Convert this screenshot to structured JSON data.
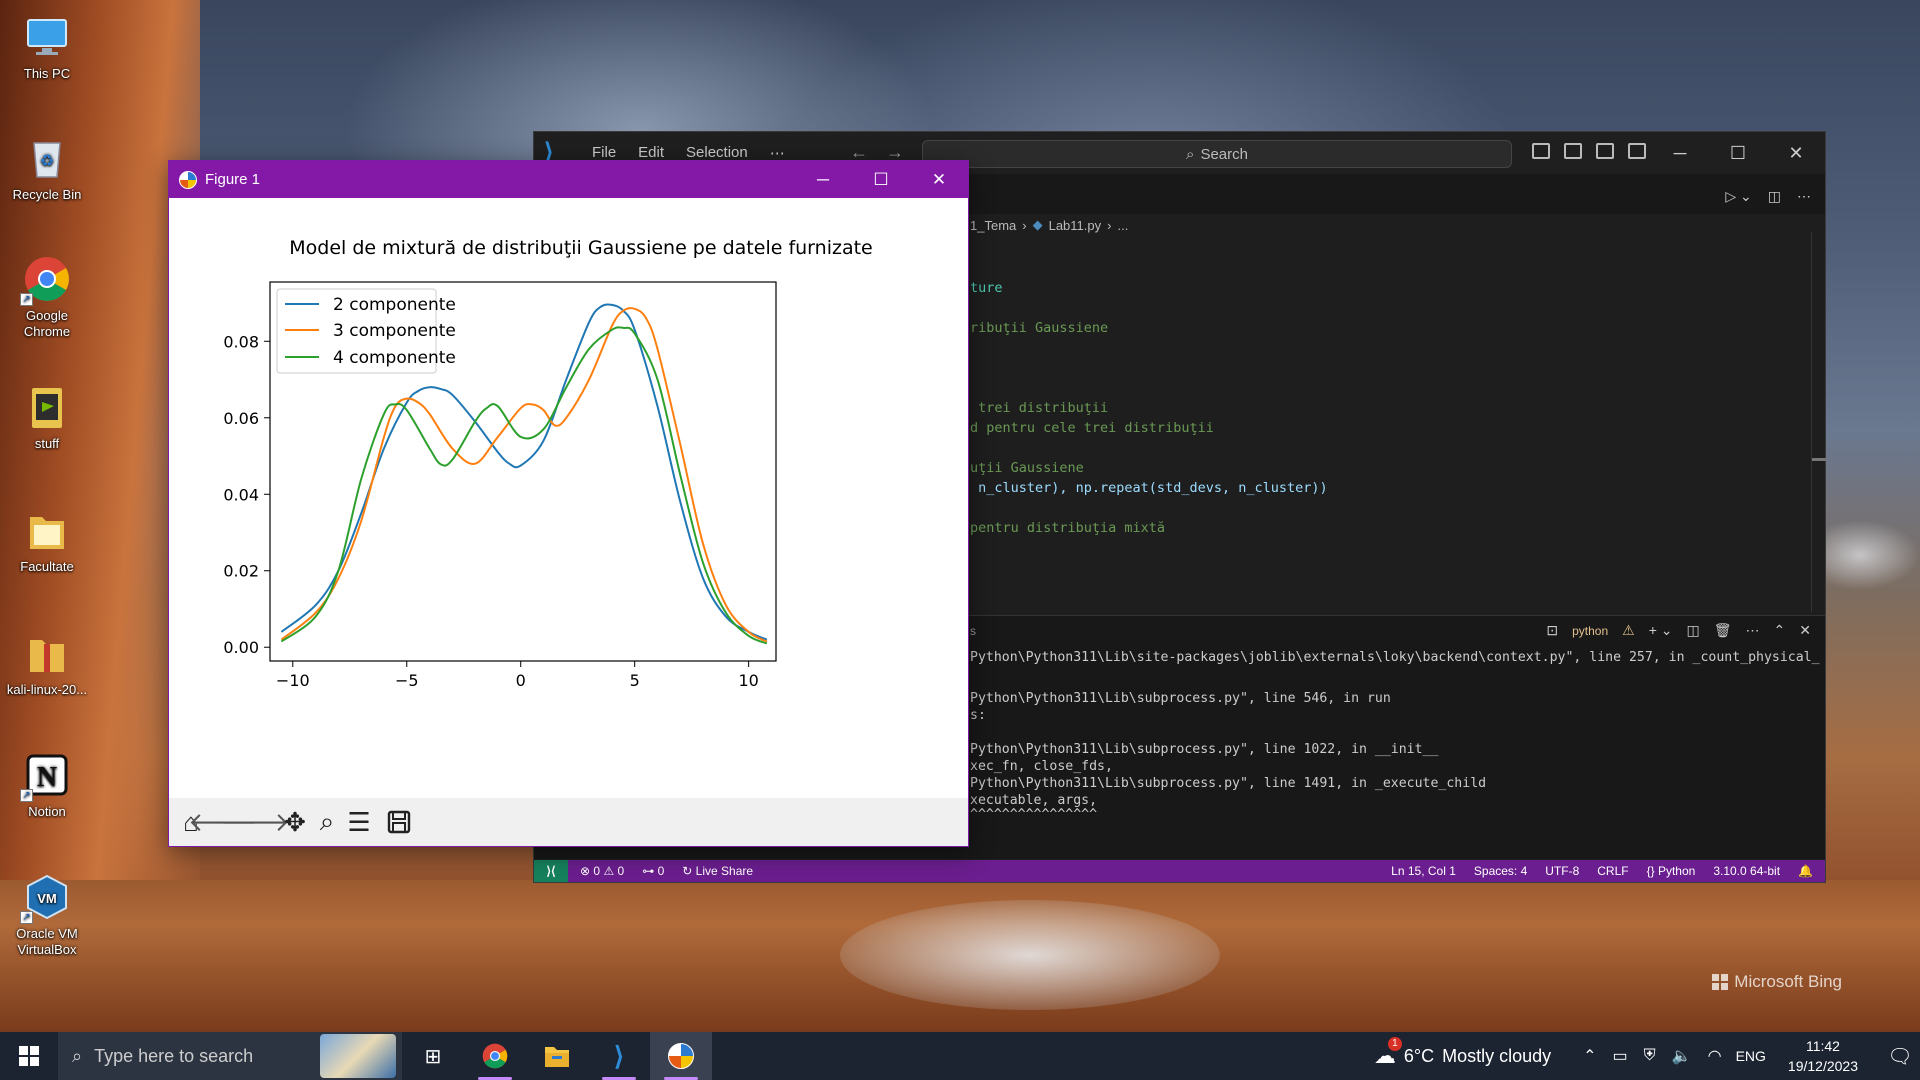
{
  "desktop": {
    "icons": [
      {
        "label": "This PC",
        "icon": "monitor-icon"
      },
      {
        "label": "Recycle Bin",
        "icon": "recycle-bin-icon"
      },
      {
        "label": "Google Chrome",
        "icon": "chrome-icon"
      },
      {
        "label": "stuff",
        "icon": "folder-icon"
      },
      {
        "label": "Facultate",
        "icon": "folder-icon"
      },
      {
        "label": "kali-linux-20...",
        "icon": "zip-folder-icon"
      },
      {
        "label": "Notion",
        "icon": "notion-icon"
      },
      {
        "label": "Oracle VM VirtualBox",
        "icon": "virtualbox-icon"
      }
    ],
    "watermark": "Microsoft Bing"
  },
  "vscode": {
    "menu": [
      "File",
      "Edit",
      "Selection",
      "⋯"
    ],
    "search_placeholder": "Search",
    "breadcrumb": {
      "folder": "1_Tema",
      "file": "Lab11.py",
      "more": "..."
    },
    "code_lines": [
      {
        "text": "ture",
        "class": "c-cls"
      },
      {
        "text": "ribuţii Gaussiene",
        "class": "c-cmt"
      },
      {
        "text": " trei distribuţii",
        "class": "c-cmt"
      },
      {
        "text": "d pentru cele trei distribuţii",
        "class": "c-cmt"
      },
      {
        "text": "uţii Gaussiene",
        "class": "c-cmt"
      },
      {
        "text": " n_cluster), np.repeat(std_devs, n_cluster))",
        "class": "c-var"
      },
      {
        "text": "pentru distribuţia mixtă",
        "class": "c-cmt"
      }
    ],
    "panel": {
      "tab_fragment": "s",
      "terminal_label": "python",
      "terminal_lines": [
        "Python\\Python311\\Lib\\site-packages\\joblib\\externals\\loky\\backend\\context.py\", line 257, in _count_physical_",
        "",
        "Python\\Python311\\Lib\\subprocess.py\", line 546, in run",
        "s:",
        "",
        "Python\\Python311\\Lib\\subprocess.py\", line 1022, in __init__",
        "xec_fn, close_fds,",
        "Python\\Python311\\Lib\\subprocess.py\", line 1491, in _execute_child",
        "xecutable, args,",
        "^^^^^^^^^^^^^^^^"
      ]
    },
    "status": {
      "errors": "0",
      "warnings": "0",
      "ports": "0",
      "live_share": "Live Share",
      "position": "Ln 15, Col 1",
      "spaces": "Spaces: 4",
      "encoding": "UTF-8",
      "eol": "CRLF",
      "language": "Python",
      "interpreter": "3.10.0 64-bit"
    },
    "colors": {
      "status_bar": "#6b1e8f",
      "remote": "#16825d"
    }
  },
  "figure": {
    "window_title": "Figure 1",
    "title_bar_color": "#8419a8",
    "toolbar": [
      "home-icon",
      "back-arrow-icon",
      "forward-arrow-icon",
      "pan-icon",
      "zoom-icon",
      "configure-subplots-icon",
      "save-icon"
    ]
  },
  "chart_data": {
    "type": "line",
    "title": "Model de mixtură de distribuţii Gaussiene pe datele furnizate",
    "xlabel": "",
    "ylabel": "",
    "xlim": [
      -11,
      11.2
    ],
    "ylim": [
      -0.0036,
      0.0955
    ],
    "xticks": [
      -10,
      -5,
      0,
      5,
      10
    ],
    "xtick_labels": [
      "−10",
      "−5",
      "0",
      "5",
      "10"
    ],
    "yticks": [
      0.0,
      0.02,
      0.04,
      0.06,
      0.08
    ],
    "ytick_labels": [
      "0.00",
      "0.02",
      "0.04",
      "0.06",
      "0.08"
    ],
    "legend_position": "upper-left",
    "grid": false,
    "series": [
      {
        "name": "2 componente",
        "color": "#1f77b4",
        "x": [
          -10.5,
          -9,
          -8,
          -7,
          -6,
          -5,
          -4.5,
          -4,
          -3.5,
          -3,
          -2,
          -1,
          -0.5,
          0,
          1,
          2,
          3,
          3.5,
          4,
          4.5,
          5,
          6,
          7,
          8,
          9,
          10,
          10.8
        ],
        "y": [
          0.004,
          0.011,
          0.02,
          0.035,
          0.052,
          0.064,
          0.067,
          0.068,
          0.0675,
          0.066,
          0.059,
          0.051,
          0.048,
          0.0475,
          0.054,
          0.07,
          0.085,
          0.089,
          0.0895,
          0.088,
          0.083,
          0.063,
          0.038,
          0.018,
          0.008,
          0.004,
          0.002
        ]
      },
      {
        "name": "3 componente",
        "color": "#ff7f0e",
        "x": [
          -10.5,
          -9,
          -8,
          -7,
          -6,
          -5.5,
          -5,
          -4.5,
          -4,
          -3,
          -2,
          -1,
          0,
          0.5,
          1,
          1.5,
          2,
          3,
          4,
          4.5,
          5,
          5.5,
          6,
          7,
          8,
          9,
          10,
          10.8
        ],
        "y": [
          0.002,
          0.009,
          0.018,
          0.033,
          0.055,
          0.063,
          0.065,
          0.064,
          0.061,
          0.052,
          0.048,
          0.055,
          0.0625,
          0.0635,
          0.062,
          0.058,
          0.06,
          0.07,
          0.084,
          0.088,
          0.0885,
          0.086,
          0.078,
          0.053,
          0.027,
          0.011,
          0.004,
          0.0015
        ]
      },
      {
        "name": "4 componente",
        "color": "#2ca02c",
        "x": [
          -10.5,
          -9,
          -8,
          -7,
          -6,
          -5.5,
          -5,
          -4,
          -3.5,
          -3,
          -2,
          -1.5,
          -1,
          0,
          1,
          2,
          3,
          4,
          4.5,
          5,
          6,
          7,
          8,
          9,
          10,
          10.8
        ],
        "y": [
          0.0015,
          0.008,
          0.02,
          0.044,
          0.061,
          0.0635,
          0.062,
          0.052,
          0.0478,
          0.049,
          0.059,
          0.0625,
          0.063,
          0.055,
          0.057,
          0.068,
          0.078,
          0.083,
          0.0835,
          0.082,
          0.07,
          0.045,
          0.022,
          0.009,
          0.003,
          0.001
        ]
      }
    ]
  },
  "taskbar": {
    "search_placeholder": "Type here to search",
    "apps": [
      "task-view-icon",
      "chrome-icon",
      "file-explorer-icon",
      "vscode-icon",
      "matplotlib-icon"
    ],
    "weather": {
      "temp": "6°C",
      "desc": "Mostly cloudy",
      "badge": "1"
    },
    "language": "ENG",
    "time": "11:42",
    "date": "19/12/2023"
  }
}
